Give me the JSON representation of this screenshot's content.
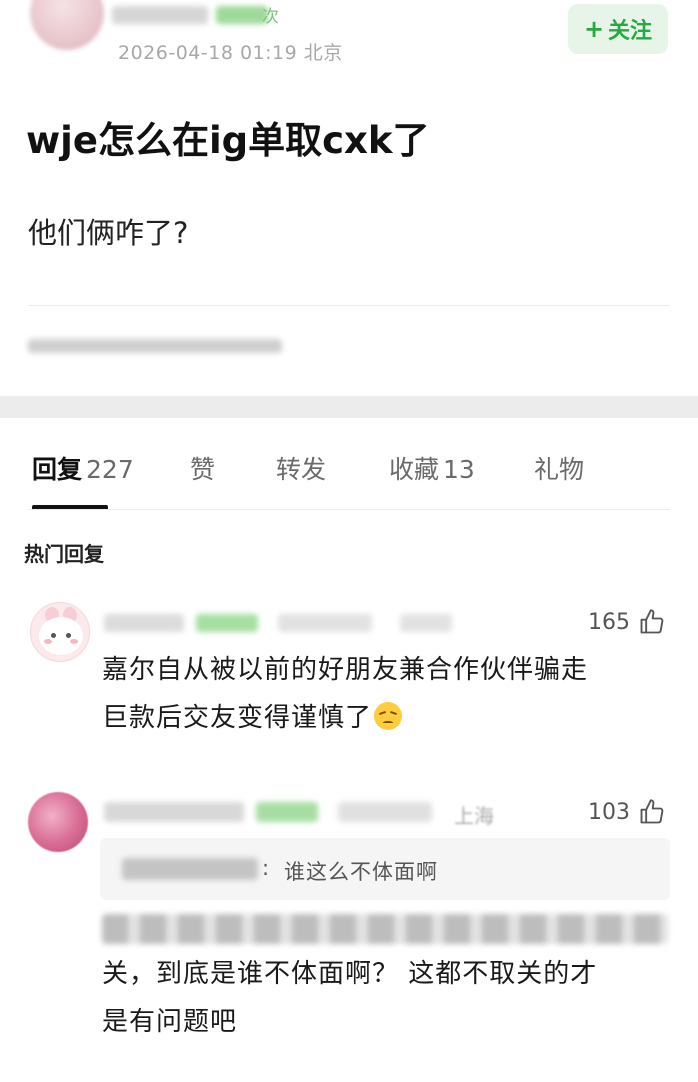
{
  "post": {
    "timestamp": "2026-04-18 01:19",
    "location": "北京",
    "follow_label": "关注",
    "title": "wje怎么在ig单取cxk了",
    "body": "他们俩咋了?"
  },
  "tabs": [
    {
      "label": "回复",
      "count": "227"
    },
    {
      "label": "赞",
      "count": ""
    },
    {
      "label": "转发",
      "count": ""
    },
    {
      "label": "收藏",
      "count": "13"
    },
    {
      "label": "礼物",
      "count": ""
    }
  ],
  "section_label": "热门回复",
  "comments": [
    {
      "likes": "165",
      "text_line1": "嘉尔自从被以前的好朋友兼合作伙伴骗走",
      "text_line2": "巨款后交友变得谨慎了"
    },
    {
      "likes": "103",
      "location": "上海",
      "quote_text": "谁这么不体面啊",
      "text_line2": "关，到底是谁不体面啊？ 这都不取关的才",
      "text_line3": "是有问题吧"
    }
  ],
  "icons": {
    "like": "thumbs-up-icon",
    "follow": "plus-icon",
    "emoji": "disappointed-face-icon"
  },
  "colors": {
    "accent_green": "#27a844",
    "follow_bg": "#e7f5e9",
    "band": "#ececec"
  }
}
